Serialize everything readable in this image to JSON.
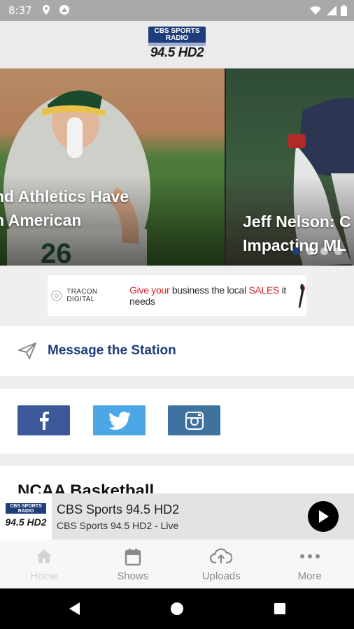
{
  "status_bar": {
    "time": "8:37"
  },
  "header": {
    "logo_top": "CBS SPORTS RADIO",
    "logo_freq": "94.5 HD2"
  },
  "carousel": {
    "slides": [
      {
        "title_line1": "nd Athletics Have",
        "title_line2": "n American"
      },
      {
        "title_line1": "Jeff Nelson: C",
        "title_line2": "Impacting ML"
      }
    ]
  },
  "ad": {
    "brand": "TRACON DIGITAL",
    "text_pre": "Give your",
    "text_mid": " business the local ",
    "text_sales": "SALES",
    "text_post": " it needs"
  },
  "message": {
    "label": "Message the Station"
  },
  "section": {
    "title": "NCAA Basketball"
  },
  "player": {
    "logo_top": "CBS SPORTS RADIO",
    "logo_freq": "94.5 HD2",
    "title": "CBS Sports 94.5 HD2",
    "subtitle": "CBS Sports 94.5 HD2 - Live"
  },
  "tabs": [
    {
      "label": "Home",
      "icon": "home-icon"
    },
    {
      "label": "Shows",
      "icon": "calendar-icon"
    },
    {
      "label": "Uploads",
      "icon": "cloud-upload-icon"
    },
    {
      "label": "More",
      "icon": "more-dots-icon"
    }
  ],
  "colors": {
    "brand_blue": "#1f3d7a",
    "facebook": "#3b5998",
    "twitter": "#4da7e6",
    "instagram": "#3e729f"
  }
}
